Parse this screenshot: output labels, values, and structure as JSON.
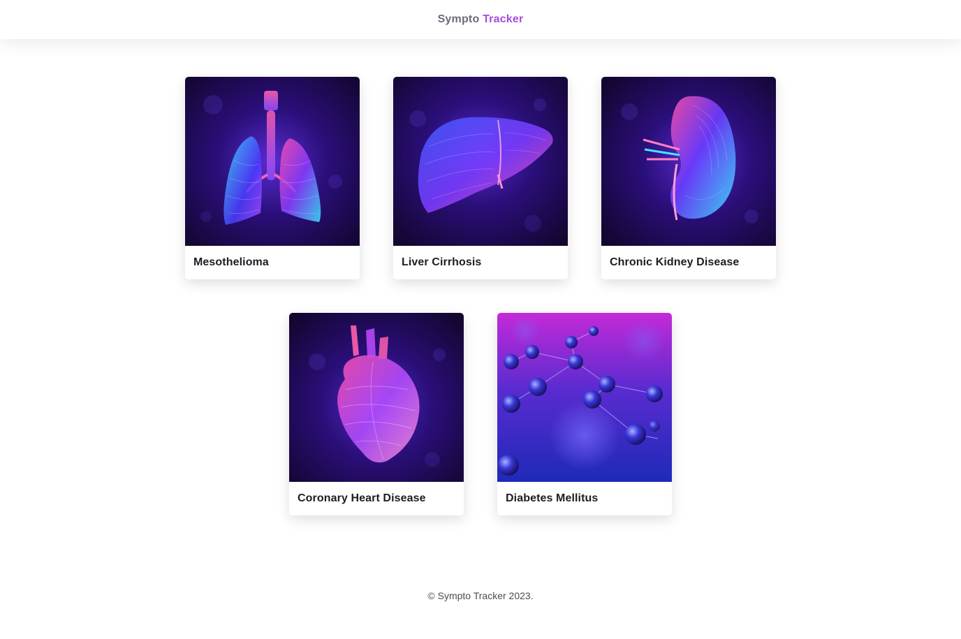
{
  "header": {
    "brand_part1": "Sympto",
    "brand_part2": "Tracker",
    "brand_colors": {
      "part1": "#6b6b7b",
      "part2": "#a54be0"
    }
  },
  "cards": [
    {
      "title": "Mesothelioma",
      "icon": "lungs-illustration"
    },
    {
      "title": "Liver Cirrhosis",
      "icon": "liver-illustration"
    },
    {
      "title": "Chronic Kidney Disease",
      "icon": "kidney-illustration"
    },
    {
      "title": "Coronary Heart Disease",
      "icon": "heart-illustration"
    },
    {
      "title": "Diabetes Mellitus",
      "icon": "molecules-illustration"
    }
  ],
  "footer": {
    "text": "© Sympto Tracker 2023."
  },
  "colors": {
    "image_bg_dark": "#1a0740",
    "neon_pink": "#ff3fa8",
    "neon_cyan": "#3de8ff",
    "neon_blue": "#4b3cff",
    "neon_violet": "#b04bff"
  }
}
